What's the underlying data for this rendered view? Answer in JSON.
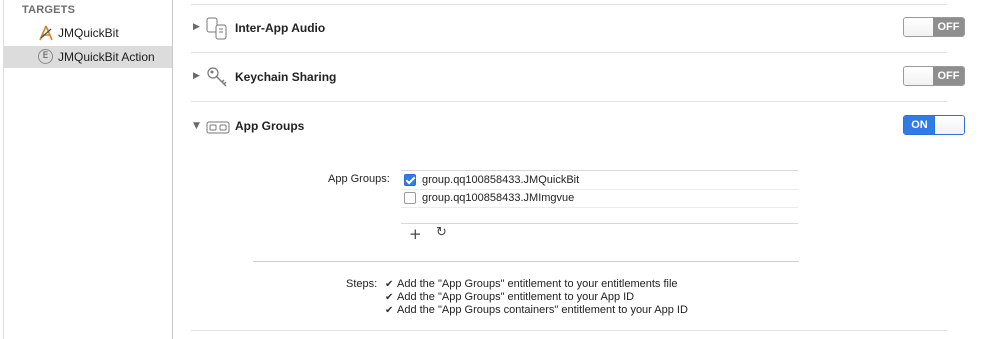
{
  "sidebar": {
    "header": "TARGETS",
    "targets": [
      {
        "label": "JMQuickBit",
        "icon": "app-target-icon",
        "selected": false
      },
      {
        "label": "JMQuickBit Action",
        "icon": "extension-target-icon",
        "icon_glyph": "E",
        "selected": true
      }
    ]
  },
  "capabilities": [
    {
      "title": "Inter-App Audio",
      "expanded": false,
      "icon": "inter-app-audio-icon",
      "toggle": "OFF"
    },
    {
      "title": "Keychain Sharing",
      "expanded": false,
      "icon": "keychain-icon",
      "toggle": "OFF"
    },
    {
      "title": "App Groups",
      "expanded": true,
      "icon": "app-groups-icon",
      "toggle": "ON"
    }
  ],
  "app_groups": {
    "label": "App Groups:",
    "items": [
      {
        "name": "group.qq100858433.JMQuickBit",
        "checked": true
      },
      {
        "name": "group.qq100858433.JMImgvue",
        "checked": false
      }
    ],
    "add_glyph": "+",
    "refresh_glyph": "↻"
  },
  "steps": {
    "label": "Steps:",
    "check_glyph": "✔",
    "items": [
      "Add the \"App Groups\" entitlement to your entitlements file",
      "Add the \"App Groups\" entitlement to your App ID",
      "Add the \"App Groups containers\" entitlement to your App ID"
    ]
  },
  "colors": {
    "toggle_on": "#2f7be8",
    "toggle_off": "#8e8e8e",
    "selection": "#dcdcdc"
  }
}
